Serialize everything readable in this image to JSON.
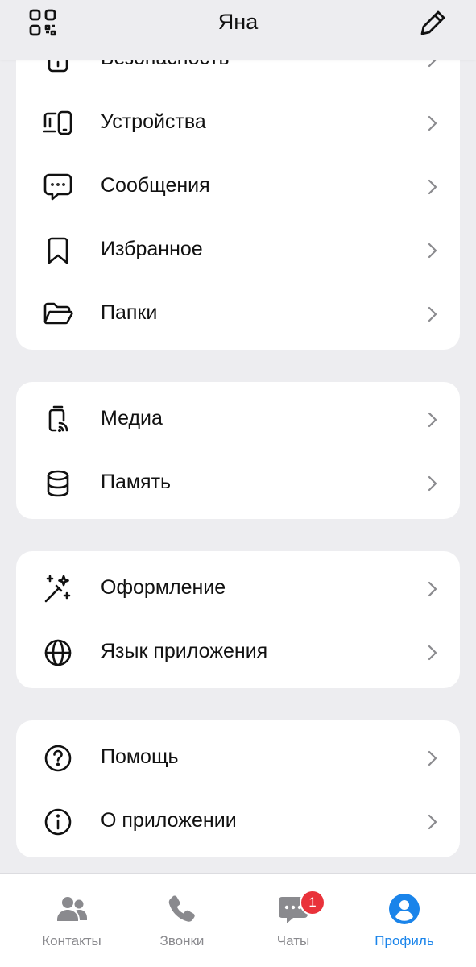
{
  "header": {
    "title": "Яна",
    "left_icon": "qr-code-icon",
    "right_icon": "pencil-icon"
  },
  "sections": [
    {
      "items": [
        {
          "label": "Безопасность",
          "icon": "lock-icon"
        },
        {
          "label": "Устройства",
          "icon": "devices-icon"
        },
        {
          "label": "Сообщения",
          "icon": "message-bubble-icon"
        },
        {
          "label": "Избранное",
          "icon": "bookmark-icon"
        },
        {
          "label": "Папки",
          "icon": "folder-icon"
        }
      ]
    },
    {
      "items": [
        {
          "label": "Медиа",
          "icon": "media-icon"
        },
        {
          "label": "Память",
          "icon": "database-icon"
        }
      ]
    },
    {
      "items": [
        {
          "label": "Оформление",
          "icon": "magic-wand-icon"
        },
        {
          "label": "Язык приложения",
          "icon": "globe-icon"
        }
      ]
    },
    {
      "items": [
        {
          "label": "Помощь",
          "icon": "help-circle-icon"
        },
        {
          "label": "О приложении",
          "icon": "info-circle-icon"
        }
      ]
    }
  ],
  "tabbar": {
    "tabs": [
      {
        "label": "Контакты",
        "icon": "contacts-icon"
      },
      {
        "label": "Звонки",
        "icon": "phone-icon"
      },
      {
        "label": "Чаты",
        "icon": "chat-icon",
        "badge": "1"
      },
      {
        "label": "Профиль",
        "icon": "profile-icon",
        "active": true
      }
    ]
  },
  "colors": {
    "accent": "#1a84ea",
    "badge": "#e9323a",
    "background": "#ededf0",
    "card": "#ffffff",
    "inactive": "#8a8a8e"
  }
}
